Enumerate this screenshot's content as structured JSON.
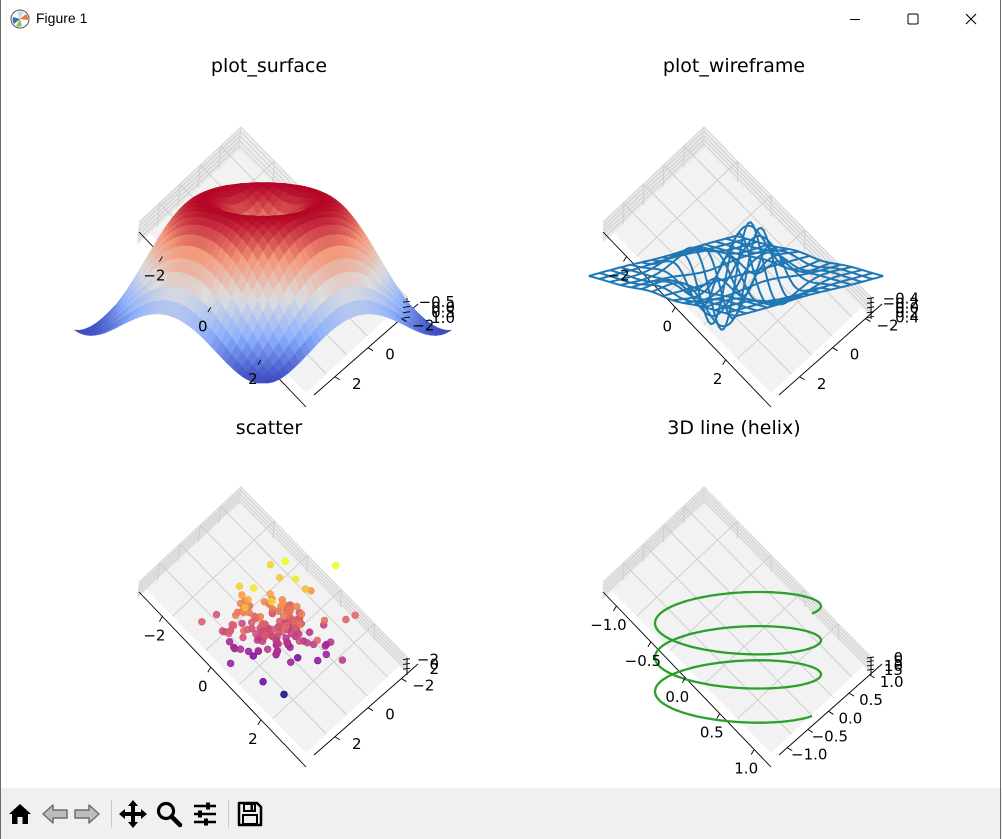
{
  "window": {
    "title": "Figure 1",
    "controls": [
      "minimize",
      "maximize",
      "close"
    ]
  },
  "toolbar": {
    "buttons": [
      {
        "icon": "home-icon",
        "label": "Home"
      },
      {
        "icon": "back-icon",
        "label": "Back"
      },
      {
        "icon": "forward-icon",
        "label": "Forward"
      },
      {
        "icon": "pan-icon",
        "label": "Pan"
      },
      {
        "icon": "zoom-icon",
        "label": "Zoom"
      },
      {
        "icon": "configure-subplots-icon",
        "label": "Configure subplots"
      },
      {
        "icon": "save-icon",
        "label": "Save"
      }
    ]
  },
  "colors": {
    "wireframe": "#1f77b4",
    "helix": "#2ca02c",
    "pane": "#f2f2f2",
    "grid": "#cccccc"
  },
  "chart_data": [
    {
      "type": "surface",
      "title": "plot_surface",
      "colormap": "coolwarm",
      "function": "sin(sqrt(x^2 + y^2))",
      "x_ticks": [
        "−2",
        "0",
        "2"
      ],
      "y_ticks": [
        "−2",
        "0",
        "2"
      ],
      "z_ticks": [
        "1.0",
        "0.5",
        "0.0",
        "−0.5"
      ],
      "xlim": [
        -3,
        3
      ],
      "ylim": [
        -3,
        3
      ],
      "zlim": [
        -1,
        1
      ]
    },
    {
      "type": "wireframe",
      "title": "plot_wireframe",
      "x_ticks": [
        "−2",
        "0",
        "2"
      ],
      "y_ticks": [
        "−2",
        "0",
        "2"
      ],
      "z_ticks": [
        "0.4",
        "0.2",
        "0.0",
        "−0.2",
        "−0.4"
      ],
      "xlim": [
        -3,
        3
      ],
      "ylim": [
        -3,
        3
      ],
      "zlim": [
        -0.45,
        0.45
      ]
    },
    {
      "type": "scatter",
      "title": "scatter",
      "colormap": "plasma",
      "x_ticks": [
        "−2",
        "0",
        "2"
      ],
      "y_ticks": [
        "−2",
        "0",
        "2"
      ],
      "z_ticks": [
        "2",
        "0",
        "−2"
      ],
      "xlim": [
        -3,
        3
      ],
      "ylim": [
        -3,
        3
      ],
      "zlim": [
        -3,
        3
      ]
    },
    {
      "type": "line",
      "title": "3D line (helix)",
      "x_ticks": [
        "−1.0",
        "−0.5",
        "0.0",
        "0.5",
        "1.0"
      ],
      "y_ticks": [
        "1.0",
        "0.5",
        "0.0",
        "−0.5",
        "−1.0"
      ],
      "z_ticks": [
        "15",
        "10",
        "5",
        "0"
      ],
      "xlim": [
        -1,
        1
      ],
      "ylim": [
        -1,
        1
      ],
      "zlim": [
        0,
        18.8
      ],
      "turns": 3
    }
  ]
}
